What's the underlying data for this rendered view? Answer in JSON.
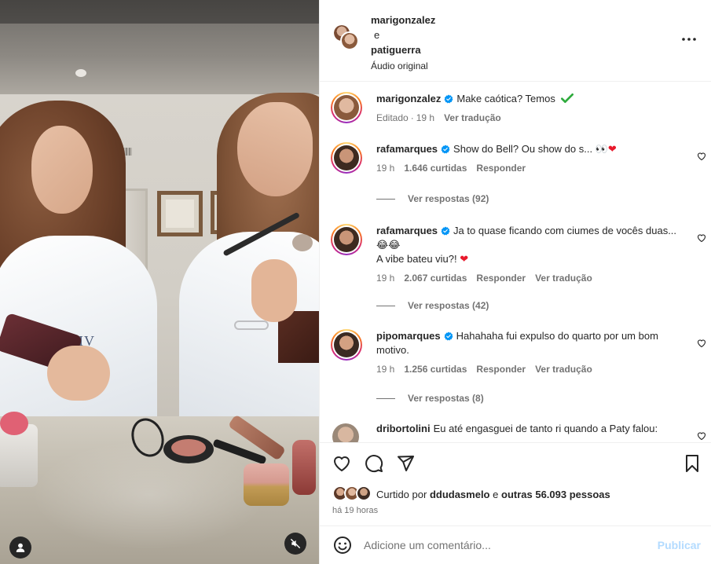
{
  "header": {
    "user1": "marigonzalez",
    "and": "e",
    "user2": "patiguerra",
    "audio": "Áudio original",
    "more_icon": "more-horizontal-icon"
  },
  "comments": [
    {
      "username": "marigonzalez",
      "verified": true,
      "text": "Make caótica? Temos",
      "emoji": "✔",
      "meta": {
        "edited": "Editado",
        "sep": "·",
        "time": "19 h",
        "translate": "Ver tradução"
      }
    },
    {
      "username": "rafamarques",
      "verified": true,
      "text": "Show do Bell? Ou show do s... 👀",
      "heart": "❤",
      "meta": {
        "time": "19 h",
        "likes": "1.646 curtidas",
        "reply": "Responder"
      },
      "replies": "Ver respostas (92)"
    },
    {
      "username": "rafamarques",
      "verified": true,
      "text": "Ja to quase ficando com ciumes de vocês duas... 😂😂",
      "text2": "A vibe bateu viu?!",
      "heart": "❤",
      "meta": {
        "time": "19 h",
        "likes": "2.067 curtidas",
        "reply": "Responder",
        "translate": "Ver tradução"
      },
      "replies": "Ver respostas (42)"
    },
    {
      "username": "pipomarques",
      "verified": true,
      "text": "Hahahaha fui expulso do quarto por um bom motivo.",
      "meta": {
        "time": "19 h",
        "likes": "1.256 curtidas",
        "reply": "Responder",
        "translate": "Ver tradução"
      },
      "replies": "Ver respostas (8)"
    },
    {
      "username": "dribortolini",
      "verified": false,
      "text": "Eu até engasguei de tanto ri quando a Paty falou:"
    }
  ],
  "actions": {
    "like_icon": "heart-icon",
    "comment_icon": "comment-icon",
    "share_icon": "send-icon",
    "save_icon": "bookmark-icon",
    "liked_by_prefix": "Curtido por",
    "liked_by_user": "ddudasmelo",
    "liked_by_connector": "e",
    "liked_by_others": "outras 56.093 pessoas",
    "time_ago": "há 19 horas"
  },
  "composer": {
    "placeholder": "Adicione um comentário...",
    "post_label": "Publicar"
  },
  "colors": {
    "verified": "#0095f6",
    "muted": "#737373",
    "post_disabled": "#b3dbff",
    "heart_red": "#ff3040"
  }
}
